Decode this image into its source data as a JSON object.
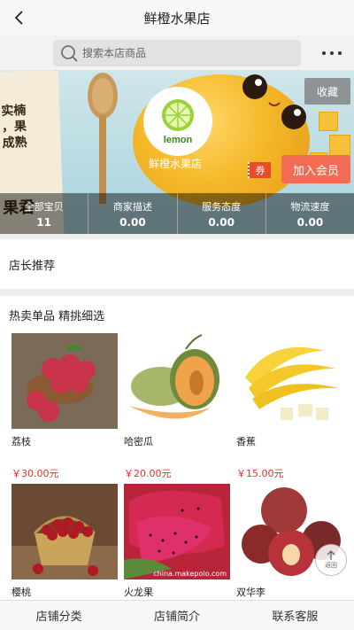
{
  "navbar": {
    "title": "鲜橙水果店"
  },
  "search": {
    "placeholder": "搜索本店商品"
  },
  "banner": {
    "store_name": "鲜橙水果店",
    "logo_text": "lemon",
    "favorite_label": "收藏",
    "coupon_label": "券",
    "join_label": "加入会员",
    "note_lines": [
      "实楠",
      "，果",
      "成熟",
      "果君"
    ]
  },
  "stats": [
    {
      "label": "全部宝贝",
      "value": "11"
    },
    {
      "label": "商家描述",
      "value": "0.00"
    },
    {
      "label": "服务态度",
      "value": "0.00"
    },
    {
      "label": "物流速度",
      "value": "0.00"
    }
  ],
  "recommend": {
    "title": "店长推荐"
  },
  "hot": {
    "title": "热卖单品 精挑细选",
    "products": [
      {
        "name": "荔枝",
        "price": "￥30.00元"
      },
      {
        "name": "哈密瓜",
        "price": "￥20.00元"
      },
      {
        "name": "香蕉",
        "price": "￥15.00元"
      },
      {
        "name": "樱桃",
        "price": ""
      },
      {
        "name": "火龙果",
        "price": ""
      },
      {
        "name": "双华李",
        "price": ""
      }
    ],
    "watermark": "china.makepolo.com"
  },
  "to_top": {
    "label": "返回"
  },
  "tabs": [
    "店铺分类",
    "店铺简介",
    "联系客服"
  ],
  "colors": {
    "accent": "#f26b52",
    "price": "#e0322a",
    "coupon": "#e84a2a"
  }
}
